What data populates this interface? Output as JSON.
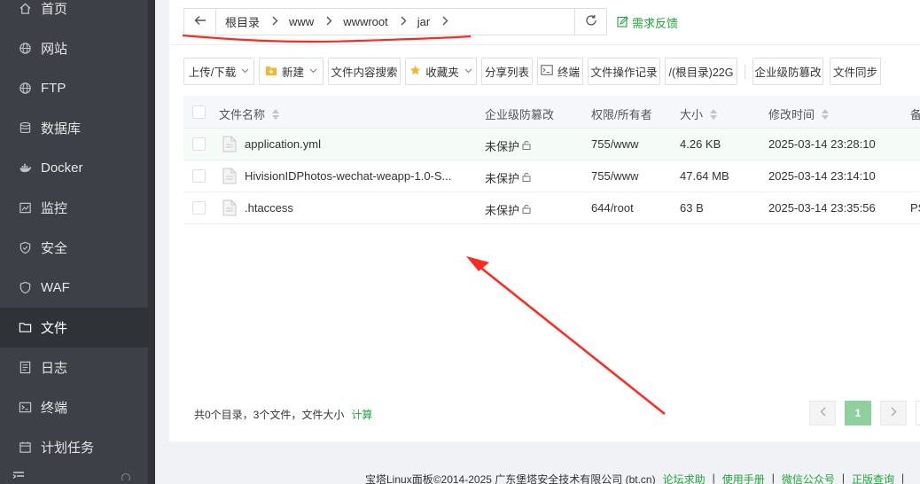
{
  "sidebar": {
    "items": [
      {
        "label": "首页",
        "icon": "home-icon"
      },
      {
        "label": "网站",
        "icon": "globe-icon"
      },
      {
        "label": "FTP",
        "icon": "globe-icon"
      },
      {
        "label": "数据库",
        "icon": "database-icon"
      },
      {
        "label": "Docker",
        "icon": "docker-icon"
      },
      {
        "label": "监控",
        "icon": "monitor-icon"
      },
      {
        "label": "安全",
        "icon": "shield-icon"
      },
      {
        "label": "WAF",
        "icon": "shield-icon"
      },
      {
        "label": "文件",
        "icon": "folder-icon"
      },
      {
        "label": "日志",
        "icon": "log-icon"
      },
      {
        "label": "终端",
        "icon": "terminal-icon"
      },
      {
        "label": "计划任务",
        "icon": "calendar-icon"
      }
    ],
    "active": "文件"
  },
  "breadcrumb": {
    "items": [
      "根目录",
      "www",
      "wwwroot",
      "jar"
    ]
  },
  "feedback_label": "需求反馈",
  "toolbar": {
    "upload_download": "上传/下载",
    "new": "新建",
    "content_search": "文件内容搜索",
    "favorites": "收藏夹",
    "share_list": "分享列表",
    "terminal": "终端",
    "op_log": "文件操作记录",
    "disk": "/(根目录)22G",
    "tamper_proof": "企业级防篡改",
    "sync": "文件同步"
  },
  "table": {
    "headers": {
      "name": "文件名称",
      "protect": "企业级防篡改",
      "perm": "权限/所有者",
      "size": "大小",
      "mtime": "修改时间",
      "remark": "备"
    },
    "rows": [
      {
        "name": "application.yml",
        "protect": "未保护",
        "perm": "755/www",
        "size": "4.26 KB",
        "mtime": "2025-03-14 23:28:10",
        "remark": ""
      },
      {
        "name": "HivisionIDPhotos-wechat-weapp-1.0-S...",
        "protect": "未保护",
        "perm": "755/www",
        "size": "47.64 MB",
        "mtime": "2025-03-14 23:14:10",
        "remark": ""
      },
      {
        "name": ".htaccess",
        "protect": "未保护",
        "perm": "644/root",
        "size": "63 B",
        "mtime": "2025-03-14 23:35:56",
        "remark": "PS"
      }
    ]
  },
  "summary": {
    "text": "共0个目录，3个文件，文件大小",
    "calc": "计算"
  },
  "pager": {
    "current": "1"
  },
  "footer": {
    "copyright": "宝塔Linux面板©2014-2025 广东堡塔安全技术有限公司 (bt.cn)",
    "links": [
      "论坛求助",
      "使用手册",
      "微信公众号",
      "正版查询"
    ]
  },
  "colors": {
    "accent": "#20a53a",
    "sidebar_bg": "#3d4147",
    "annotation": "#ff2a1f"
  }
}
